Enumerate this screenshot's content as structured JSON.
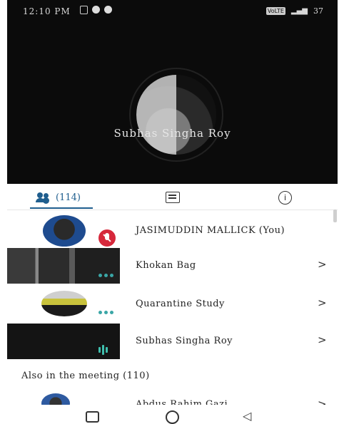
{
  "status_bar": {
    "time": "12:10 PM",
    "volte": "VoLTE",
    "battery": "37"
  },
  "active_speaker": {
    "name": "Subhas Singha Roy"
  },
  "tabs": {
    "participants_count": "(114)",
    "people_icon": "people-icon",
    "chat_icon": "chat-icon",
    "info_icon": "info-icon",
    "info_glyph": "i"
  },
  "participants": [
    {
      "name": "JASIMUDDIN MALLICK (You)",
      "status": "muted"
    },
    {
      "name": "Khokan Bag",
      "chevron": ">"
    },
    {
      "name": "Quarantine Study",
      "chevron": ">"
    },
    {
      "name": "Subhas Singha Roy",
      "chevron": ">"
    }
  ],
  "also_in_meeting": {
    "label": "Also in the meeting (110)",
    "first_partial_name": "Abdus Rahim Gazi",
    "chevron": ">"
  },
  "nav": {
    "back_glyph": "◁"
  }
}
